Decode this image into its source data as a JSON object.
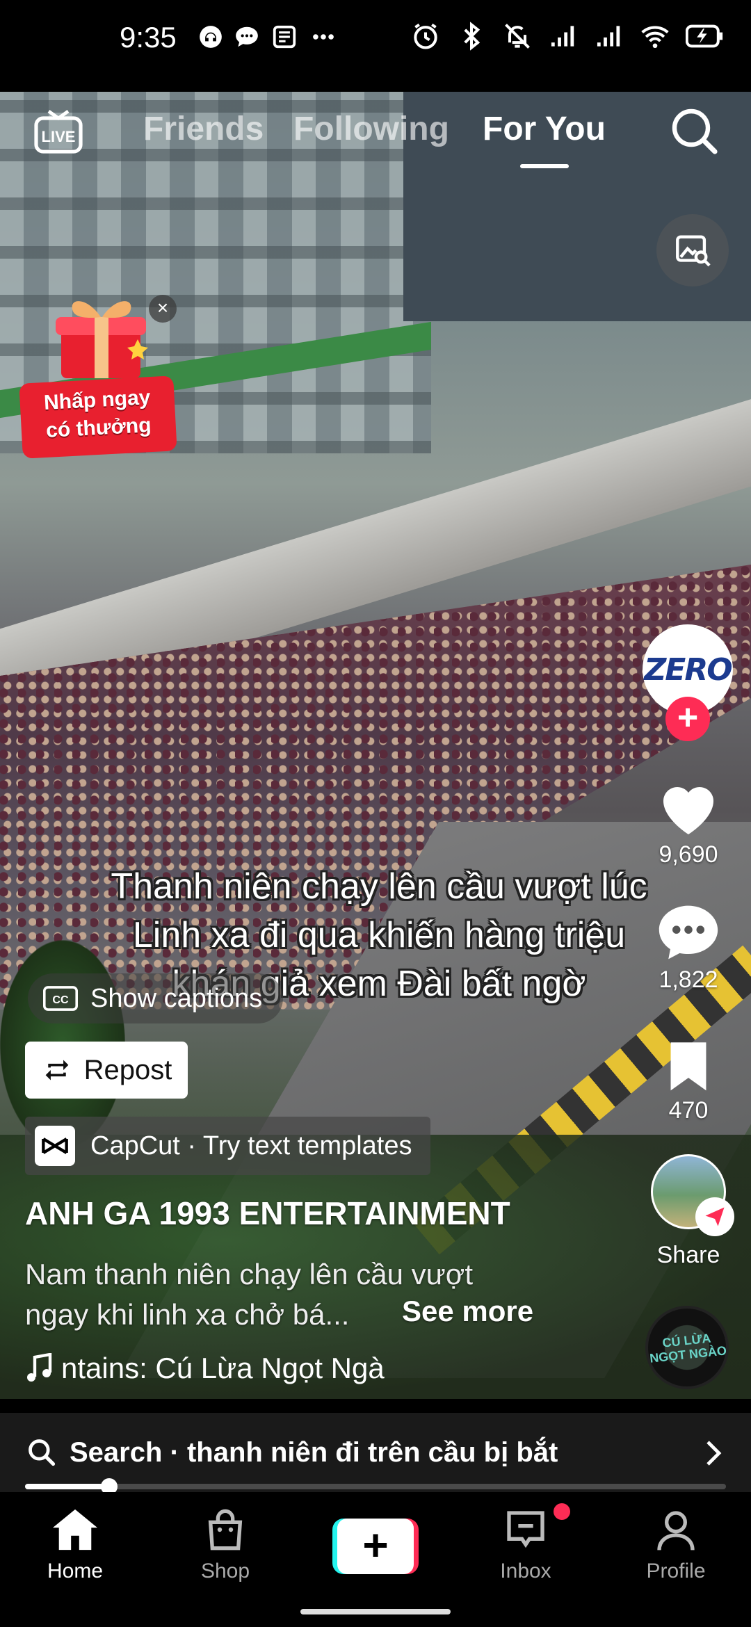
{
  "status_bar": {
    "time": "9:35",
    "left_icons": [
      "headset-icon",
      "chat-bubble-icon",
      "news-icon",
      "more-dots-icon"
    ],
    "right_icons": [
      "alarm-icon",
      "bluetooth-icon",
      "bell-off-icon",
      "signal-icon",
      "signal-icon",
      "wifi-icon",
      "battery-charging-icon"
    ]
  },
  "top_nav": {
    "live_label": "LIVE",
    "tabs": [
      {
        "label": "Friends",
        "active": false
      },
      {
        "label": "Following",
        "active": false
      },
      {
        "label": "For You",
        "active": true
      }
    ]
  },
  "promo": {
    "line1": "Nhấp ngay",
    "line2": "có thưởng",
    "close": "×"
  },
  "video": {
    "caption_overlay": "Thanh niên chạy lên cầu vượt lúc Linh xa đi qua khiến hàng triệu khán giả xem Đài bất ngờ",
    "show_captions": "Show captions",
    "repost": "Repost",
    "capcut": "CapCut · Try text templates",
    "author": "ANH GA 1993 ENTERTAINMENT",
    "description_line1": "Nam thanh niên chạy lên cầu vượt",
    "description_line2": "ngay khi linh xa chở bá...",
    "see_more": "See more",
    "sound": "ntains: Cú Lừa Ngọt Ngà"
  },
  "rail": {
    "creator_logo": "ZERO",
    "follow": "+",
    "likes": "9,690",
    "comments": "1,822",
    "saves": "470",
    "share_label": "Share",
    "disc_text_1": "CÚ LỪA",
    "disc_text_2": "NGỌT NGÀO"
  },
  "search": {
    "text": "Search · thanh niên đi trên cầu bị bắt"
  },
  "playback": {
    "progress_fraction": 0.12
  },
  "bottom_nav": {
    "home": "Home",
    "shop": "Shop",
    "create": "+",
    "inbox": "Inbox",
    "profile": "Profile"
  },
  "colors": {
    "accent_red": "#fe2c55",
    "accent_cyan": "#25f4ee",
    "background": "#000000"
  }
}
